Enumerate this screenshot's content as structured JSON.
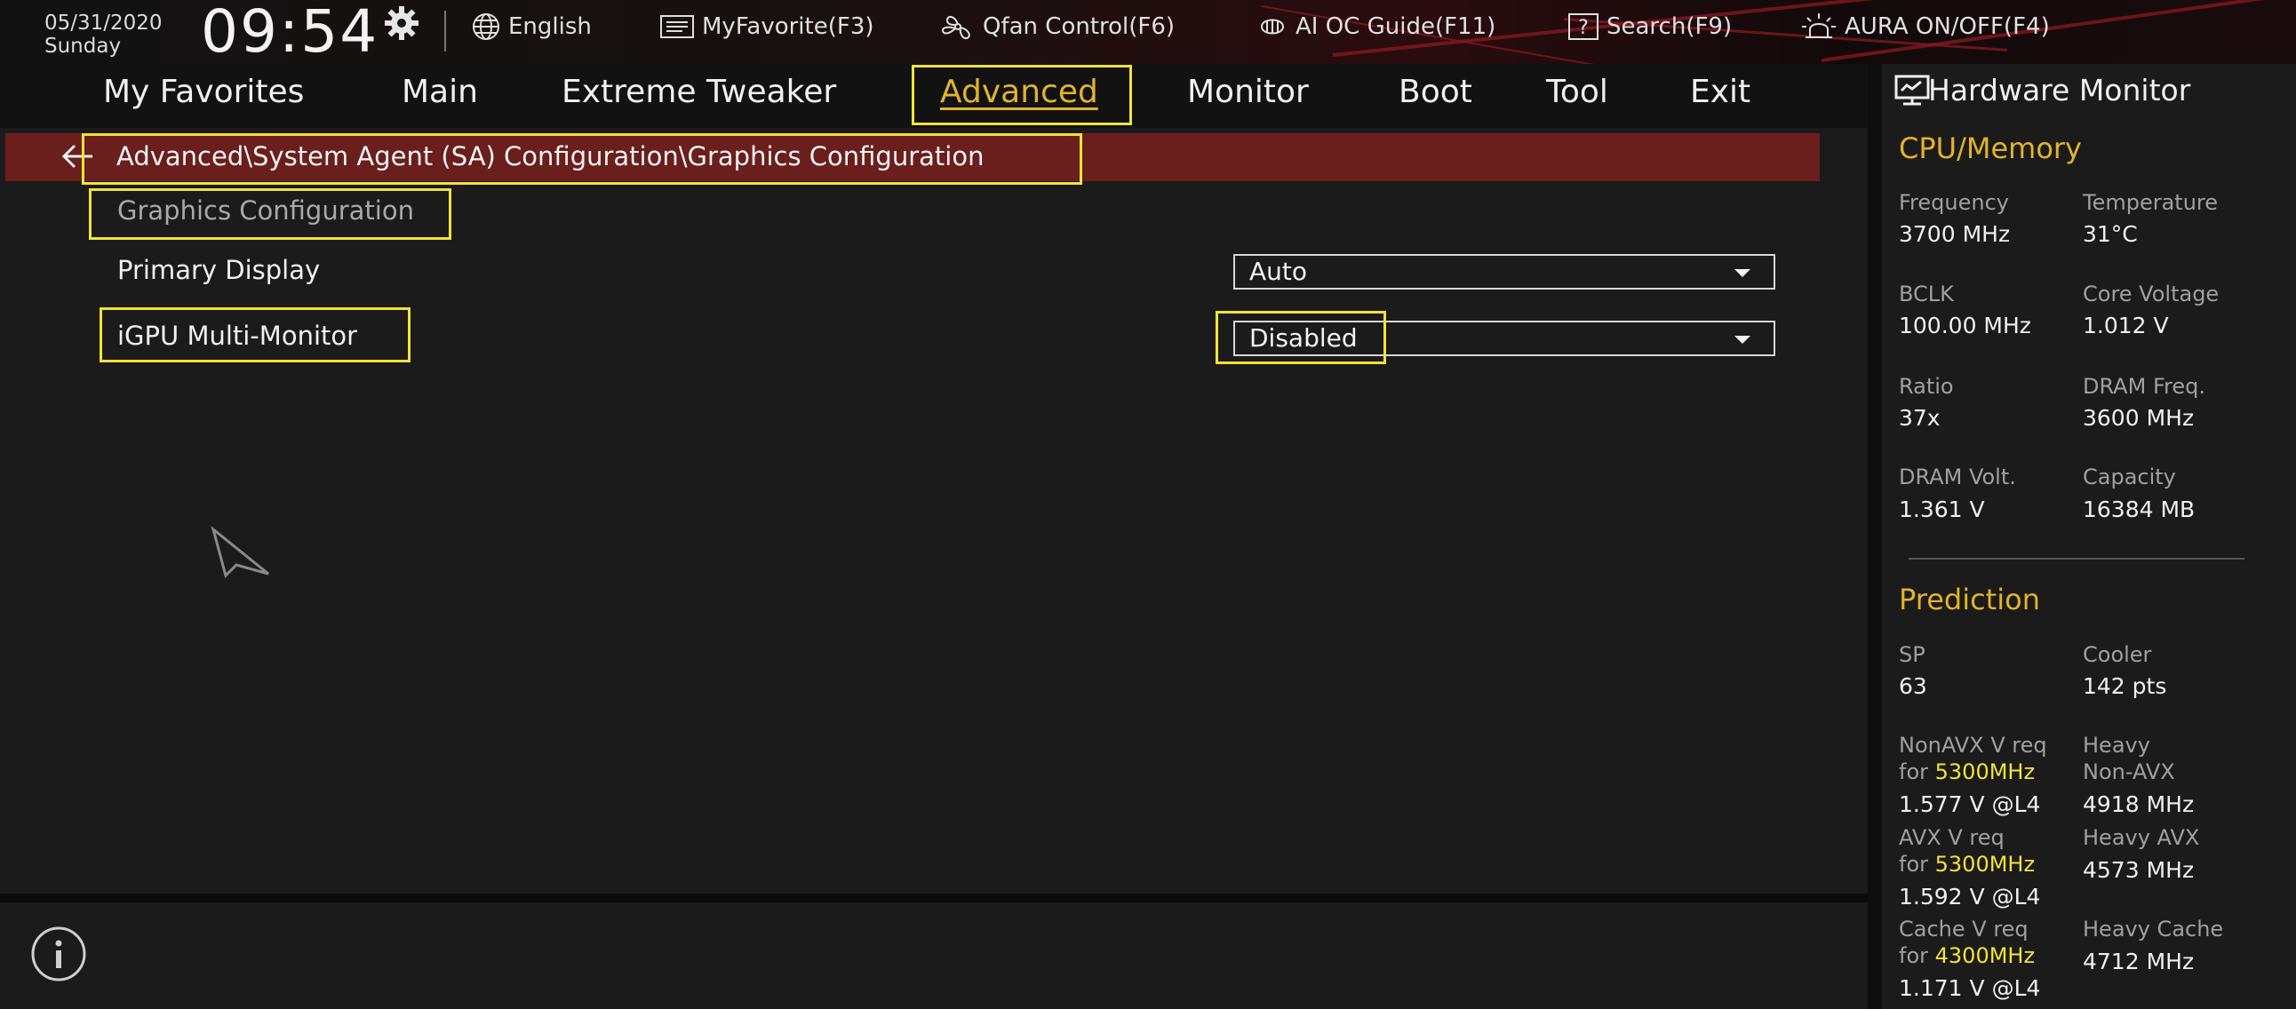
{
  "topbar": {
    "date": "05/31/2020",
    "day": "Sunday",
    "time": "09:54",
    "items": [
      {
        "label": "English",
        "icon": "globe-icon"
      },
      {
        "label": "MyFavorite(F3)",
        "icon": "favorite-icon"
      },
      {
        "label": "Qfan Control(F6)",
        "icon": "fan-icon"
      },
      {
        "label": "AI OC Guide(F11)",
        "icon": "ai-chip-icon"
      },
      {
        "label": "Search(F9)",
        "icon": "search-help-icon"
      },
      {
        "label": "AURA ON/OFF(F4)",
        "icon": "aura-light-icon"
      }
    ]
  },
  "nav": {
    "tabs": [
      "My Favorites",
      "Main",
      "Extreme Tweaker",
      "Advanced",
      "Monitor",
      "Boot",
      "Tool",
      "Exit"
    ],
    "active": "Advanced"
  },
  "breadcrumb": "Advanced\\System Agent (SA) Configuration\\Graphics Configuration",
  "section_title": "Graphics Configuration",
  "settings": [
    {
      "label": "Primary Display",
      "value": "Auto"
    },
    {
      "label": "iGPU Multi-Monitor",
      "value": "Disabled"
    }
  ],
  "hardware_monitor": {
    "title": "Hardware Monitor",
    "cpu_memory": {
      "title": "CPU/Memory",
      "frequency_label": "Frequency",
      "frequency": "3700 MHz",
      "temperature_label": "Temperature",
      "temperature": "31°C",
      "bclk_label": "BCLK",
      "bclk": "100.00 MHz",
      "core_voltage_label": "Core Voltage",
      "core_voltage": "1.012 V",
      "ratio_label": "Ratio",
      "ratio": "37x",
      "dram_freq_label": "DRAM Freq.",
      "dram_freq": "3600 MHz",
      "dram_volt_label": "DRAM Volt.",
      "dram_volt": "1.361 V",
      "capacity_label": "Capacity",
      "capacity": "16384 MB"
    },
    "prediction": {
      "title": "Prediction",
      "sp_label": "SP",
      "sp": "63",
      "cooler_label": "Cooler",
      "cooler": "142 pts",
      "nonavx_label": "NonAVX V req",
      "nonavx_for": "for",
      "nonavx_freq": "5300MHz",
      "nonavx_value": "1.577 V @L4",
      "heavy_nonavx_label1": "Heavy",
      "heavy_nonavx_label2": "Non-AVX",
      "heavy_nonavx_value": "4918 MHz",
      "avx_label": "AVX V req",
      "avx_for": "for",
      "avx_freq": "5300MHz",
      "avx_value": "1.592 V @L4",
      "heavy_avx_label": "Heavy AVX",
      "heavy_avx_value": "4573 MHz",
      "cache_label": "Cache V req",
      "cache_for": "for",
      "cache_freq": "4300MHz",
      "cache_value": "1.171 V @L4",
      "heavy_cache_label": "Heavy Cache",
      "heavy_cache_value": "4712 MHz"
    }
  },
  "colors": {
    "accent": "#e2b32b",
    "highlight_box": "#f2e338",
    "breadcrumb_bg": "#6b1f1c",
    "panel_bg": "#1b1b1b"
  }
}
